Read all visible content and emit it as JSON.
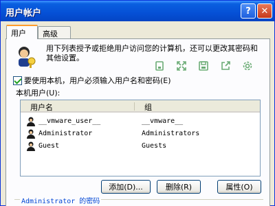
{
  "window": {
    "title": "用户帐户",
    "help_label": "?",
    "close_label": "✕"
  },
  "tabs": [
    {
      "label": "用户",
      "active": true
    },
    {
      "label": "高级",
      "active": false
    }
  ],
  "intro_text": "用下列表授予或拒绝用户访问您的计算机，还可以更改其密码和其他设置。",
  "toolbar": {
    "icons": [
      "copy-icon",
      "expand-icon",
      "save-icon",
      "share-icon",
      "settings-icon"
    ]
  },
  "require_login": {
    "label": "要使用本机，用户必须输入用户名和密码(E)",
    "checked": true
  },
  "users_label": "本机用户(U):",
  "users_table": {
    "columns": [
      "用户名",
      "组"
    ],
    "rows": [
      {
        "name": "__vmware_user__",
        "group": "__vmware__"
      },
      {
        "name": "Administrator",
        "group": "Administrators"
      },
      {
        "name": "Guest",
        "group": "Guests"
      }
    ]
  },
  "buttons": {
    "add": "添加(D)...",
    "remove": "删除(R)",
    "properties": "属性(O)"
  },
  "password_group_label": "Administrator 的密码",
  "colors": {
    "titlebar": "#0550d6",
    "tab_accent": "#ff9c2a",
    "group_label": "#0046d5"
  }
}
